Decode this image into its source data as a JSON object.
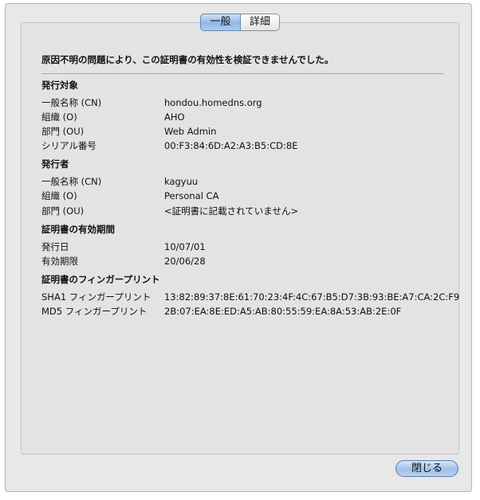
{
  "tabs": {
    "general": "一般",
    "details": "詳細"
  },
  "message": "原因不明の問題により、この証明書の有効性を検証できませんでした。",
  "subject": {
    "heading": "発行対象",
    "rows": [
      {
        "label": "一般名称 (CN)",
        "value": "hondou.homedns.org"
      },
      {
        "label": "組織 (O)",
        "value": "AHO"
      },
      {
        "label": "部門 (OU)",
        "value": "Web Admin"
      },
      {
        "label": "シリアル番号",
        "value": "00:F3:84:6D:A2:A3:B5:CD:8E"
      }
    ]
  },
  "issuer": {
    "heading": "発行者",
    "rows": [
      {
        "label": "一般名称 (CN)",
        "value": "kagyuu"
      },
      {
        "label": "組織 (O)",
        "value": "Personal CA"
      },
      {
        "label": "部門 (OU)",
        "value": "<証明書に記載されていません>"
      }
    ]
  },
  "validity": {
    "heading": "証明書の有効期間",
    "rows": [
      {
        "label": "発行日",
        "value": "10/07/01"
      },
      {
        "label": "有効期限",
        "value": "20/06/28"
      }
    ]
  },
  "fingerprints": {
    "heading": "証明書のフィンガープリント",
    "rows": [
      {
        "label": "SHA1 フィンガープリント",
        "value": "13:82:89:37:8E:61:70:23:4F:4C:67:B5:D7:3B:93:BE:A7:CA:2C:F9"
      },
      {
        "label": "MD5 フィンガープリント",
        "value": "2B:07:EA:8E:ED:A5:AB:80:55:59:EA:8A:53:AB:2E:0F"
      }
    ]
  },
  "close_label": "閉じる"
}
